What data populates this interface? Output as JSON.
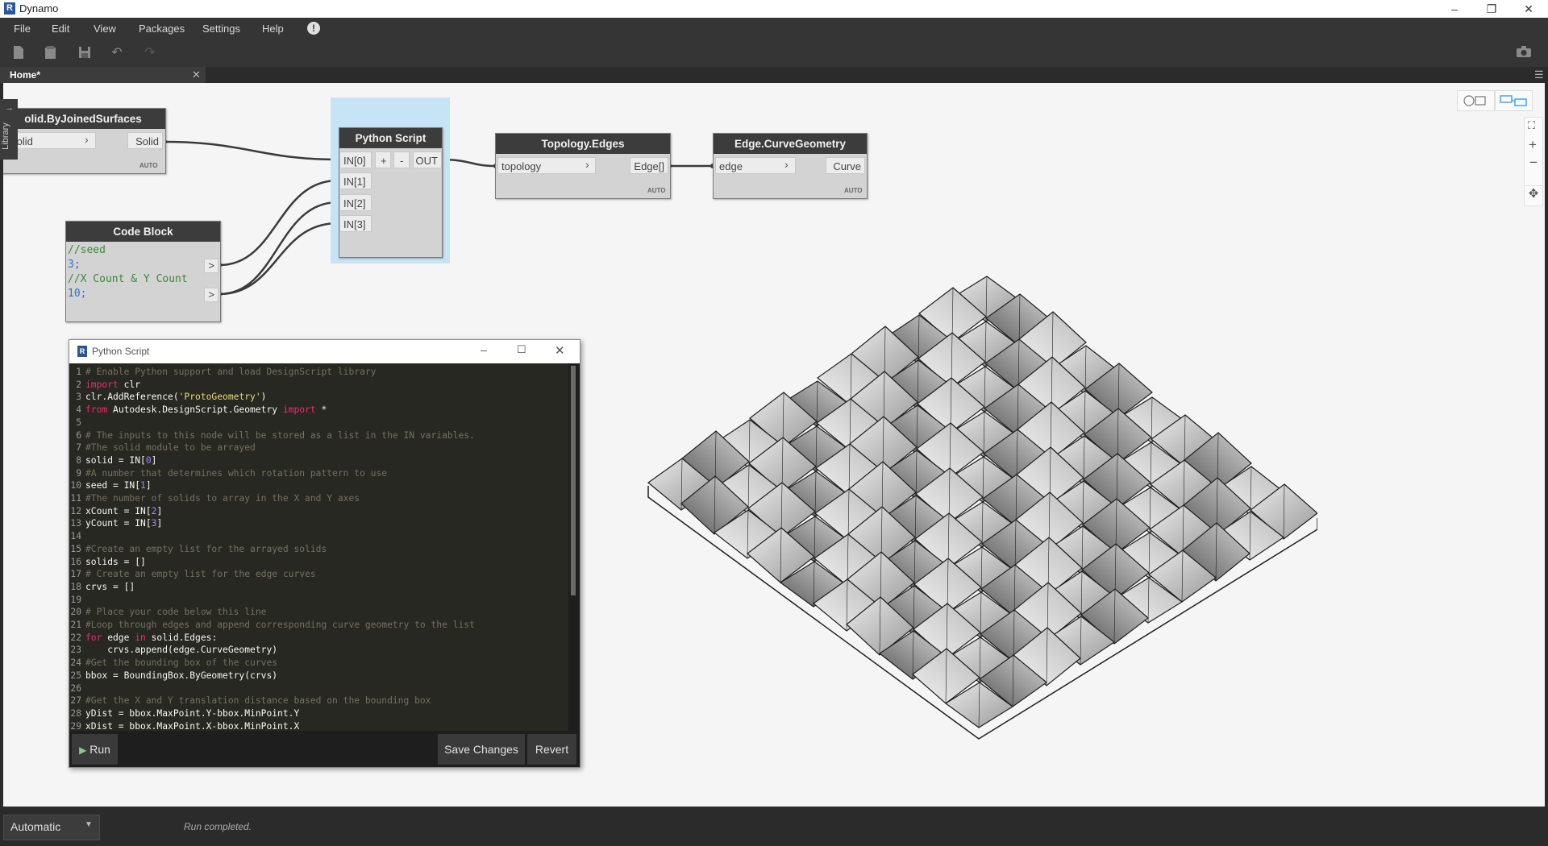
{
  "window": {
    "title": "Dynamo"
  },
  "menu": {
    "items": [
      "File",
      "Edit",
      "View",
      "Packages",
      "Settings",
      "Help"
    ]
  },
  "tab": {
    "label": "Home*"
  },
  "library": {
    "label": "Library"
  },
  "nodes": {
    "solid": {
      "title": "olid.ByJoinedSurfaces",
      "in": "Solid",
      "out": "Solid",
      "lacing": "AUTO"
    },
    "python": {
      "title": "Python Script",
      "in": [
        "IN[0]",
        "IN[1]",
        "IN[2]",
        "IN[3]"
      ],
      "add": "+",
      "remove": "-",
      "out": "OUT"
    },
    "topology": {
      "title": "Topology.Edges",
      "in": "topology",
      "out": "Edge[]",
      "lacing": "AUTO"
    },
    "edge": {
      "title": "Edge.CurveGeometry",
      "in": "edge",
      "out": "Curve",
      "lacing": "AUTO"
    },
    "codeblock": {
      "title": "Code Block",
      "lines": [
        "//seed",
        "3;",
        "//X Count & Y Count",
        "10;"
      ],
      "out": ">"
    }
  },
  "editor": {
    "title": "Python Script",
    "run": "Run",
    "save": "Save Changes",
    "revert": "Revert",
    "lines": [
      "# Enable Python support and load DesignScript library",
      "import clr",
      "clr.AddReference('ProtoGeometry')",
      "from Autodesk.DesignScript.Geometry import *",
      "",
      "# The inputs to this node will be stored as a list in the IN variables.",
      "#The solid module to be arrayed",
      "solid = IN[0]",
      "#A number that determines which rotation pattern to use",
      "seed = IN[1]",
      "#The number of solids to array in the X and Y axes",
      "xCount = IN[2]",
      "yCount = IN[3]",
      "",
      "#Create an empty list for the arrayed solids",
      "solids = []",
      "# Create an empty list for the edge curves",
      "crvs = []",
      "",
      "# Place your code below this line",
      "#Loop through edges and append corresponding curve geometry to the list",
      "for edge in solid.Edges:",
      "    crvs.append(edge.CurveGeometry)",
      "#Get the bounding box of the curves",
      "bbox = BoundingBox.ByGeometry(crvs)",
      "",
      "#Get the X and Y translation distance based on the bounding box",
      "yDist = bbox.MaxPoint.Y-bbox.MinPoint.Y",
      "xDist = bbox.MaxPoint.X-bbox.MinPoint.X"
    ]
  },
  "status": {
    "mode": "Automatic",
    "message": "Run completed."
  },
  "colors": {
    "accent": "#48a7e0",
    "canvas": "#f5f5f5",
    "node_header": "#3c3c3c"
  }
}
